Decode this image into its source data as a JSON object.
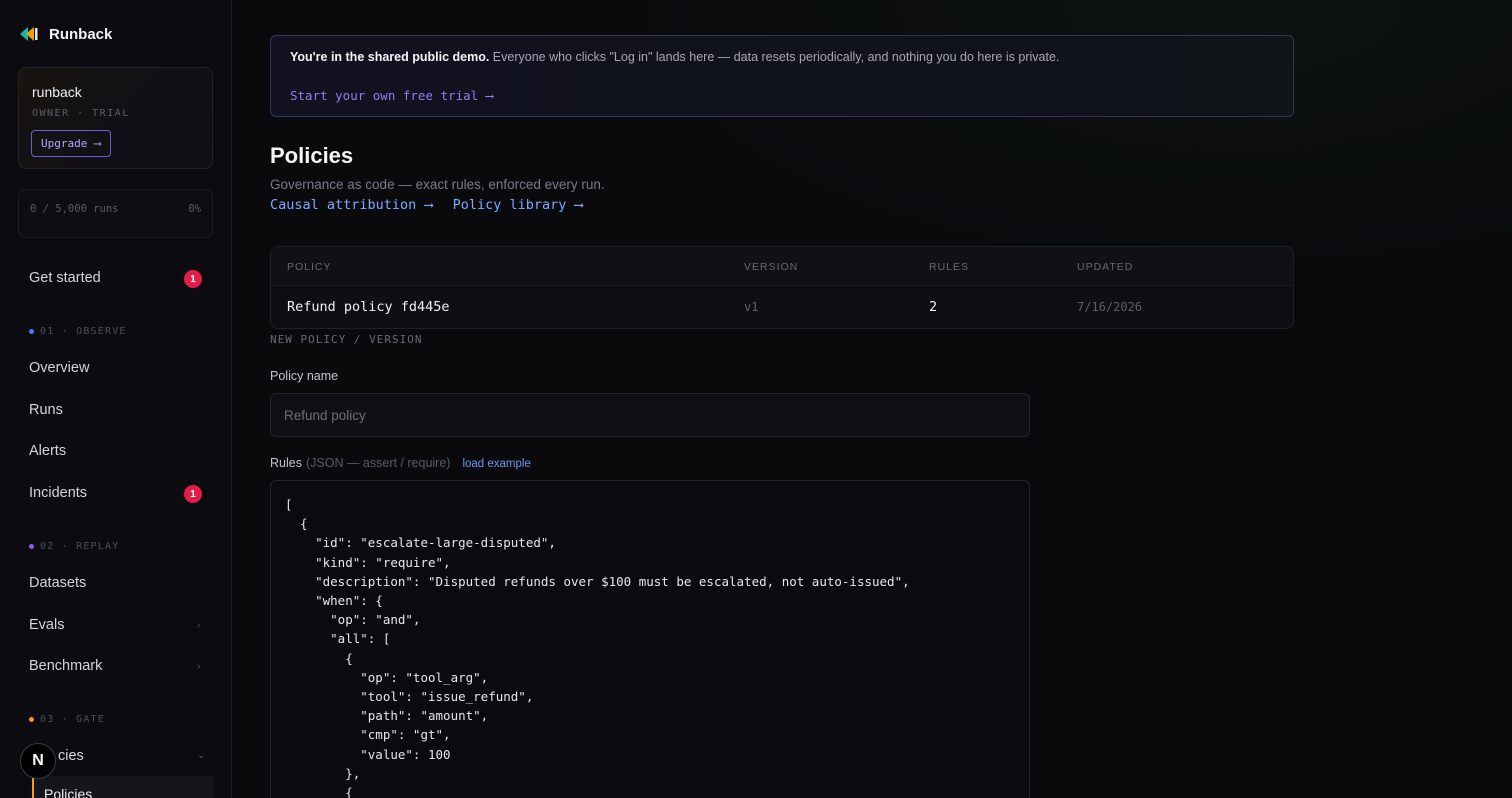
{
  "app": {
    "title": "Runback"
  },
  "org": {
    "name": "runback",
    "role": "OWNER · TRIAL",
    "upgrade_label": "Upgrade ⟶"
  },
  "usage": {
    "runs": "0 / 5,000 runs",
    "percent": "0%"
  },
  "nav": {
    "get_started": {
      "label": "Get started",
      "badge": "1"
    },
    "sections": [
      {
        "label": "01 · OBSERVE",
        "color": "#3b82f6"
      },
      {
        "label": "02 · REPLAY",
        "color": "#8b5cf6"
      },
      {
        "label": "03 · GATE",
        "color": "#f59e0b"
      }
    ],
    "overview": "Overview",
    "runs": "Runs",
    "alerts": "Alerts",
    "incidents": {
      "label": "Incidents",
      "badge": "1"
    },
    "datasets": "Datasets",
    "evals": "Evals",
    "benchmark": "Benchmark",
    "policies_group": "Policies",
    "policies_group_visible": "cies",
    "policies_sub": "Policies",
    "n_button": "N"
  },
  "banner": {
    "bold": "You're in the shared public demo.",
    "text": " Everyone who clicks \"Log in\" lands here — data resets periodically, and nothing you do here is private.",
    "link": "Start your own free trial ⟶"
  },
  "page": {
    "title": "Policies",
    "subtitle": "Governance as code — exact rules, enforced every run.",
    "link_causal": "Causal attribution ⟶",
    "link_library": "Policy library ⟶"
  },
  "table": {
    "headers": [
      "POLICY",
      "VERSION",
      "RULES",
      "UPDATED"
    ],
    "rows": [
      {
        "policy": "Refund policy fd445e",
        "version": "v1",
        "rules": "2",
        "updated": "7/16/2026"
      }
    ]
  },
  "form": {
    "section_label": "NEW POLICY / VERSION",
    "name_label": "Policy name",
    "name_placeholder": "Refund policy",
    "rules_label": "Rules",
    "rules_hint": "(JSON — assert / require)",
    "load_example": "load example",
    "rules_value": "[\n  {\n    \"id\": \"escalate-large-disputed\",\n    \"kind\": \"require\",\n    \"description\": \"Disputed refunds over $100 must be escalated, not auto-issued\",\n    \"when\": {\n      \"op\": \"and\",\n      \"all\": [\n        {\n          \"op\": \"tool_arg\",\n          \"tool\": \"issue_refund\",\n          \"path\": \"amount\",\n          \"cmp\": \"gt\",\n          \"value\": 100\n        },\n        {"
  }
}
